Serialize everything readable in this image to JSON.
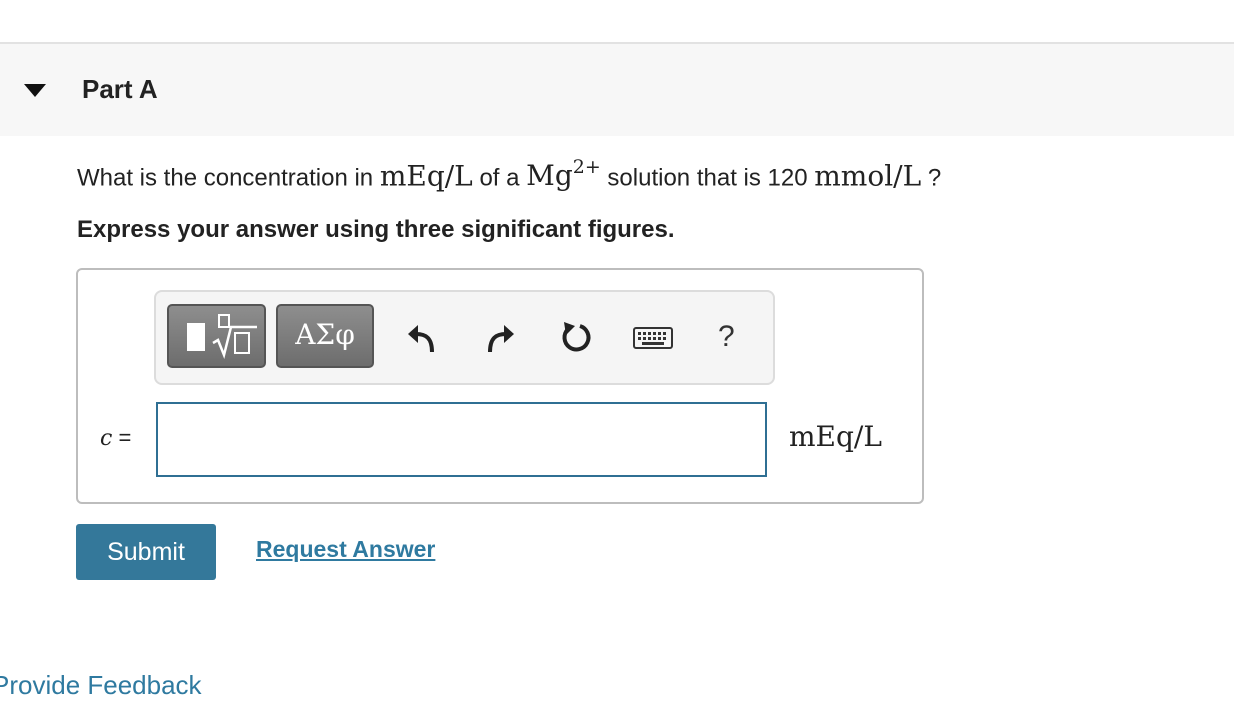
{
  "part": {
    "title": "Part A"
  },
  "question": {
    "pre": "What is the concentration in ",
    "unit1": "mEq/L",
    "mid": " of a ",
    "ion": "Mg",
    "ion_charge": "2+",
    "post": " solution that is 120 ",
    "unit2": "mmol/L",
    "end": " ?"
  },
  "instruction": "Express your answer using three significant figures.",
  "toolbar": {
    "greek_label": "ΑΣφ",
    "help_label": "?"
  },
  "answer": {
    "variable": "c",
    "equals": " =",
    "value": "",
    "unit": "mEq/L"
  },
  "actions": {
    "submit_label": "Submit",
    "request_label": "Request Answer"
  },
  "footer": {
    "feedback_label": "Provide Feedback"
  }
}
